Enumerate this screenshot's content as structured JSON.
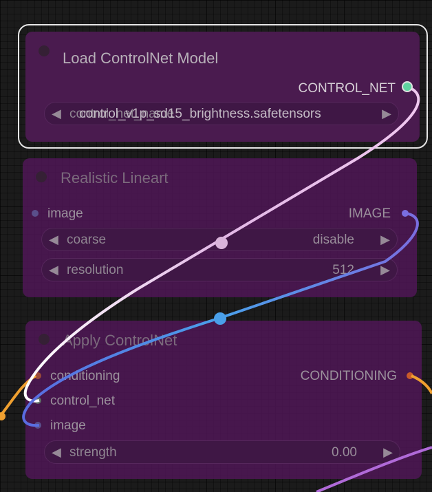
{
  "nodes": {
    "load_controlnet": {
      "title": "Load ControlNet Model",
      "output_label": "CONTROL_NET",
      "model_widget": {
        "label": "control_net_name",
        "value": "control_v1p_sd15_brightness.safetensors"
      }
    },
    "realistic_lineart": {
      "title": "Realistic Lineart",
      "input_label": "image",
      "output_label": "IMAGE",
      "coarse_widget": {
        "label": "coarse",
        "value": "disable"
      },
      "resolution_widget": {
        "label": "resolution",
        "value": "512"
      }
    },
    "apply_controlnet": {
      "title": "Apply ControlNet",
      "inputs": [
        "conditioning",
        "control_net",
        "image"
      ],
      "output_label": "CONDITIONING",
      "strength_widget": {
        "label": "strength",
        "value": "0.00"
      }
    }
  },
  "glyphs": {
    "left_arrow": "◀",
    "right_arrow": "▶"
  },
  "colors": {
    "node_bg": "#4a1b4f",
    "control_net_link": "#e8b8e8",
    "image_link": "#6c7fe0",
    "conditioning_link": "#f0a030",
    "control_net_port": "#5fd3a0"
  }
}
